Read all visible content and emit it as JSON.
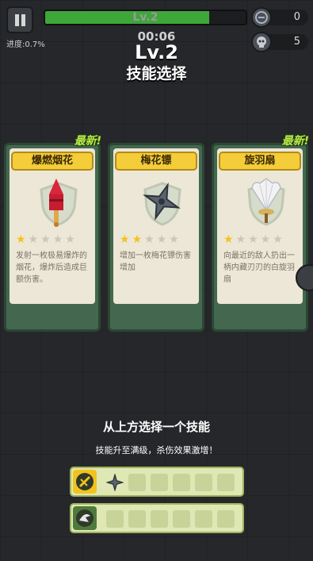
{
  "hud": {
    "progress_label": "进度:0.7%",
    "progress_fraction": 0.007,
    "xp_fraction": 0.82,
    "level_label": "Lv.2",
    "timer": "00:06",
    "coins": "0",
    "kills": "5"
  },
  "title": {
    "level": "Lv.2",
    "heading": "技能选择"
  },
  "cards": [
    {
      "badge": "最新!",
      "name": "爆燃烟花",
      "stars": 1,
      "max_stars": 5,
      "icon": "firework-rocket-icon",
      "desc": "发射一枚极易爆炸的烟花，爆炸后造成巨额伤害。"
    },
    {
      "badge": "",
      "name": "梅花镖",
      "stars": 2,
      "max_stars": 5,
      "icon": "shuriken-icon",
      "desc": "增加一枚梅花镖伤害增加"
    },
    {
      "badge": "最新!",
      "name": "旋羽扇",
      "stars": 1,
      "max_stars": 5,
      "icon": "feather-fan-icon",
      "desc": "向最近的敌人扔出一柄内藏刃刃的白旋羽扇"
    }
  ],
  "footer": {
    "prompt": "从上方选择一个技能",
    "hint": "技能升至满级，杀伤效果激增！",
    "weapon_slots_icon": "weapon-icon",
    "passive_slots_icon": "passive-icon"
  },
  "colors": {
    "accent_yellow": "#f3cd3a",
    "new_green": "#b8e84a",
    "card_green": "#44684f"
  }
}
